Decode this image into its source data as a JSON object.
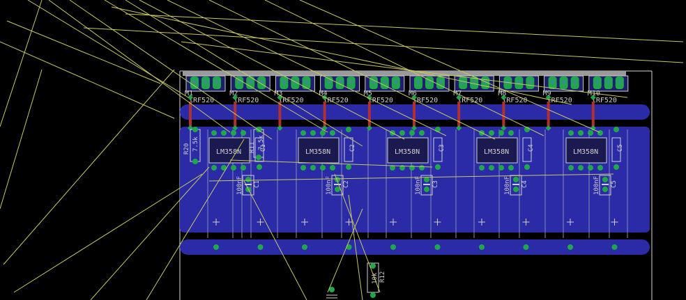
{
  "colors": {
    "background": "#000000",
    "copper_bottom": "#2b2ba8",
    "copper_top": "#b03030",
    "pad": "#1fa84a",
    "via_hole": "#3c8c8c",
    "silkscreen": "#cfcfcf",
    "airwire": "#c8c864"
  },
  "mosfets": [
    {
      "ref": "M1",
      "value": "IRF520"
    },
    {
      "ref": "M2",
      "value": "IRF520"
    },
    {
      "ref": "M3",
      "value": "IRF520"
    },
    {
      "ref": "M4",
      "value": "IRF520"
    },
    {
      "ref": "M5",
      "value": "IRF520"
    },
    {
      "ref": "M6",
      "value": "IRF520"
    },
    {
      "ref": "M7",
      "value": "IRF520"
    },
    {
      "ref": "M8",
      "value": "IRF520"
    },
    {
      "ref": "M9",
      "value": "IRF520"
    },
    {
      "ref": "M10",
      "value": "IRF520"
    }
  ],
  "opamps": [
    {
      "value": "LM358N"
    },
    {
      "value": "LM358N"
    },
    {
      "value": "LM358N"
    },
    {
      "value": "LM358N"
    },
    {
      "value": "LM358N"
    }
  ],
  "capacitors": [
    {
      "ref": "C1",
      "value": "100nF"
    },
    {
      "ref": "C2",
      "value": "100nF"
    },
    {
      "ref": "C3",
      "value": "100nF"
    },
    {
      "ref": "C4",
      "value": "100nF"
    },
    {
      "ref": "C5",
      "value": "100nF"
    }
  ],
  "side_caps": [
    {
      "ref": "C1"
    },
    {
      "ref": "C2"
    },
    {
      "ref": "C3"
    },
    {
      "ref": "C4"
    },
    {
      "ref": "C5"
    }
  ],
  "resistors": {
    "r20": {
      "ref": "R20",
      "value": "7.5k"
    },
    "r11": {
      "ref": "R11",
      "value": "7.5k"
    },
    "r12": {
      "ref": "R12",
      "value": "10k"
    }
  }
}
